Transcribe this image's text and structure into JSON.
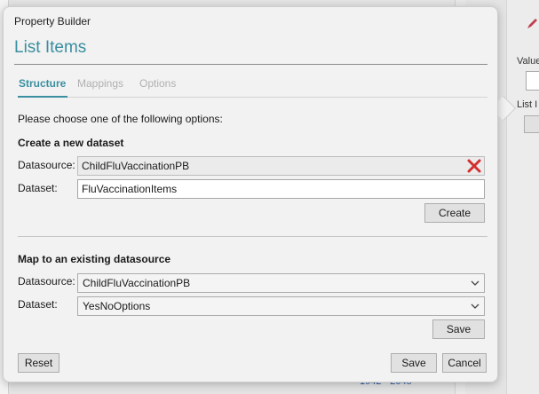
{
  "background": {
    "right_label_value": "Value",
    "right_label_list": "List I",
    "footer_text": "1942 - 2045"
  },
  "dialog": {
    "window_title": "Property Builder",
    "heading": "List Items",
    "tabs": [
      {
        "label": "Structure",
        "active": true
      },
      {
        "label": "Mappings",
        "active": false
      },
      {
        "label": "Options",
        "active": false
      }
    ],
    "instruction": "Please choose one of the following options:",
    "create_section": {
      "title": "Create a new dataset",
      "datasource_label": "Datasource:",
      "datasource_value": "ChildFluVaccinationPB",
      "dataset_label": "Dataset:",
      "dataset_value": "FluVaccinationItems",
      "create_button": "Create"
    },
    "map_section": {
      "title": "Map to an existing datasource",
      "datasource_label": "Datasource:",
      "datasource_value": "ChildFluVaccinationPB",
      "dataset_label": "Dataset:",
      "dataset_value": "YesNoOptions",
      "save_button": "Save"
    },
    "footer": {
      "reset_button": "Reset",
      "save_button": "Save",
      "cancel_button": "Cancel"
    }
  },
  "colors": {
    "accent": "#3a8fa0",
    "clear_icon": "#d32f2f",
    "link": "#2f5fa5"
  }
}
